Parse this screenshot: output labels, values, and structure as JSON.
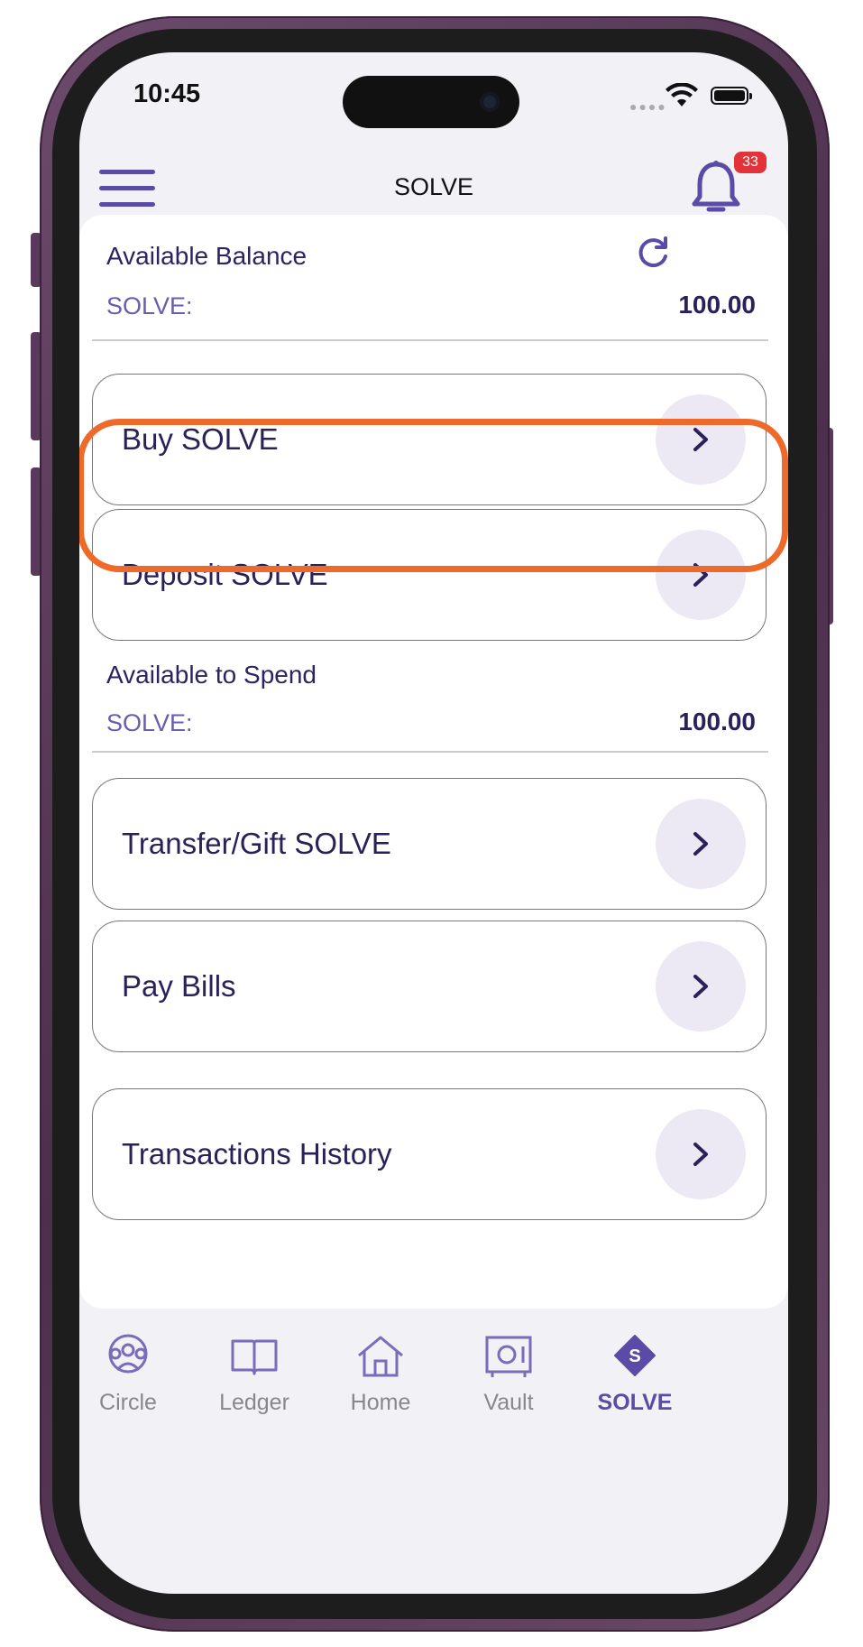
{
  "status_bar": {
    "time": "10:45"
  },
  "header": {
    "title": "SOLVE",
    "notification_count": "33"
  },
  "balance": {
    "label": "Available Balance",
    "currency": "SOLVE:",
    "amount": "100.00"
  },
  "actions_top": [
    {
      "label": "Buy SOLVE"
    },
    {
      "label": "Deposit SOLVE"
    }
  ],
  "spend": {
    "label": "Available to Spend",
    "currency": "SOLVE:",
    "amount": "100.00"
  },
  "actions_bottom": [
    {
      "label": "Transfer/Gift SOLVE"
    },
    {
      "label": "Pay Bills"
    },
    {
      "label": "Transactions History"
    }
  ],
  "tabs": [
    {
      "label": "Circle",
      "icon": "circle-people-icon"
    },
    {
      "label": "Ledger",
      "icon": "book-icon"
    },
    {
      "label": "Home",
      "icon": "home-icon"
    },
    {
      "label": "Vault",
      "icon": "vault-icon"
    },
    {
      "label": "SOLVE",
      "icon": "solve-diamond-icon",
      "active": true
    }
  ],
  "colors": {
    "accent": "#5b4ba6",
    "text_primary": "#2a2158",
    "highlight": "#ee6a2a",
    "badge": "#e23339"
  }
}
